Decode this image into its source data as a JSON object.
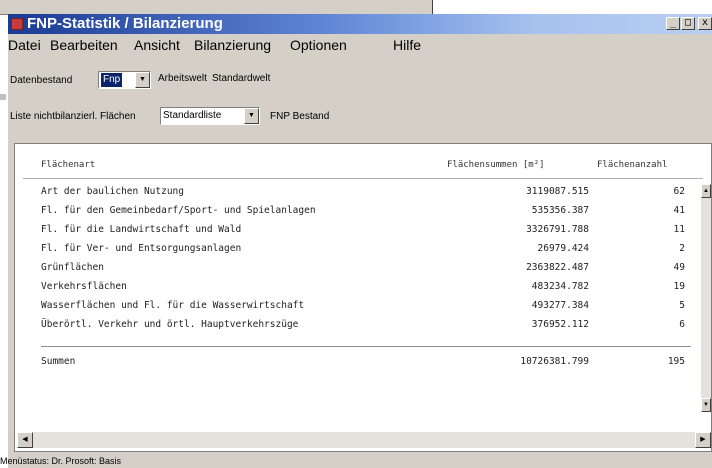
{
  "window": {
    "title": "FNP-Statistik / Bilanzierung",
    "minimize_glyph": "_",
    "maximize_glyph": "□",
    "close_glyph": "x"
  },
  "menu": {
    "items": [
      "Datei",
      "Bearbeiten",
      "Ansicht",
      "Bilanzierung",
      "Optionen",
      "Hilfe"
    ]
  },
  "toolbar": {
    "datenbestand_label": "Datenbestand",
    "datenbestand_value": "Fnp",
    "arbeitswelt_label": "Arbeitswelt",
    "standardwelt_label": "Standardwelt",
    "liste_label": "Liste nichtbilanzierl. Flächen",
    "liste_value": "Standardliste",
    "fnp_bestand_label": "FNP Bestand"
  },
  "table": {
    "columns": [
      "Flächenart",
      "Flächensummen [m²]",
      "Flächenanzahl"
    ],
    "rows": [
      {
        "flaechenart": "Art der baulichen Nutzung",
        "summe": "3119087.515",
        "anzahl": "62"
      },
      {
        "flaechenart": "Fl. für den Gemeinbedarf/Sport- und Spielanlagen",
        "summe": "535356.387",
        "anzahl": "41"
      },
      {
        "flaechenart": "Fl. für die Landwirtschaft und Wald",
        "summe": "3326791.788",
        "anzahl": "11"
      },
      {
        "flaechenart": "Fl. für Ver- und Entsorgungsanlagen",
        "summe": "26979.424",
        "anzahl": "2"
      },
      {
        "flaechenart": "Grünflächen",
        "summe": "2363822.487",
        "anzahl": "49"
      },
      {
        "flaechenart": "Verkehrsflächen",
        "summe": "483234.782",
        "anzahl": "19"
      },
      {
        "flaechenart": "Wasserflächen und Fl. für die Wasserwirtschaft",
        "summe": "493277.384",
        "anzahl": "5"
      },
      {
        "flaechenart": "Überörtl. Verkehr und örtl. Hauptverkehrszüge",
        "summe": "376952.112",
        "anzahl": "6"
      }
    ],
    "total": {
      "label": "Summen",
      "summe": "10726381.799",
      "anzahl": "195"
    }
  },
  "status": {
    "text": "Menüstatus: Dr. Prosoft: Basis"
  }
}
